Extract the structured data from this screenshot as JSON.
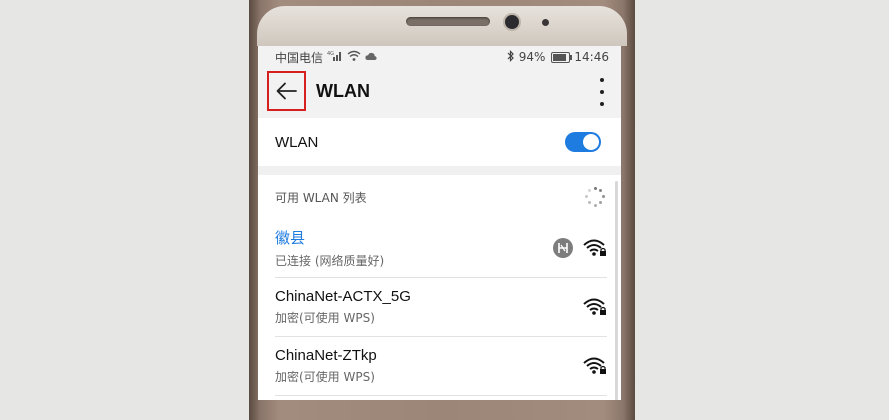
{
  "status_bar": {
    "carrier": "中国电信",
    "network": "4G",
    "battery": "94%",
    "time": "14:46"
  },
  "app_bar": {
    "title": "WLAN"
  },
  "wlan_toggle": {
    "label": "WLAN",
    "on": true
  },
  "networks_section": {
    "header": "可用 WLAN 列表",
    "networks": [
      {
        "name": "徽县",
        "status": "已连接 (网络质量好)",
        "connected": true
      },
      {
        "name": "ChinaNet-ACTX_5G",
        "status": "加密(可使用 WPS)",
        "connected": false
      },
      {
        "name": "ChinaNet-ZTkp",
        "status": "加密(可使用 WPS)",
        "connected": false
      }
    ]
  },
  "colors": {
    "accent": "#1e7be0",
    "highlight_border": "#d61f1f",
    "phone_frame": "#9c8678"
  }
}
